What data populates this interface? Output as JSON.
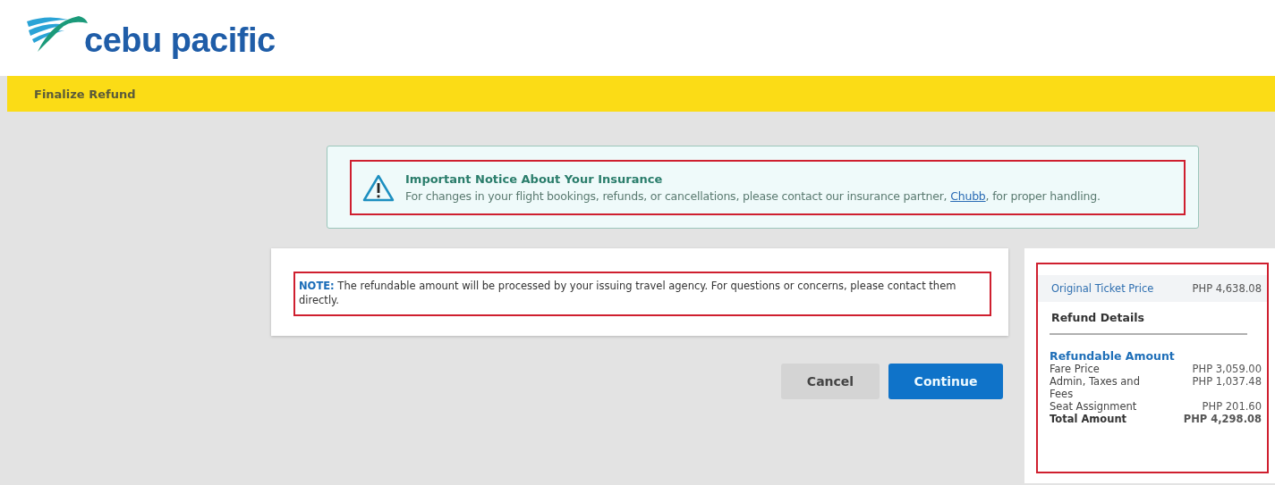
{
  "brand": {
    "name": "cebu pacific"
  },
  "page_bar": {
    "title": "Finalize Refund"
  },
  "insurance_notice": {
    "title": "Important Notice About Your Insurance",
    "text_before": "For changes in your flight bookings, refunds, or cancellations, please contact our insurance partner, ",
    "link": "Chubb",
    "text_after": ", for proper handling."
  },
  "note": {
    "label": "NOTE:",
    "text": "The refundable amount will be processed by your issuing travel agency. For questions or concerns, please contact them directly."
  },
  "buttons": [
    {
      "label": "Cancel",
      "kind": "secondary"
    },
    {
      "label": "Continue",
      "kind": "primary"
    }
  ],
  "summary": {
    "original_label": "Original Ticket Price",
    "original_value": "PHP 4,638.08",
    "heading": "Refund Details",
    "section": "Refundable Amount",
    "rows": [
      {
        "label": "Fare Price",
        "value": "PHP 3,059.00",
        "kind": "item"
      },
      {
        "label": "Admin, Taxes and Fees",
        "value": "PHP 1,037.48",
        "kind": "item"
      },
      {
        "label": "Seat Assignment",
        "value": "PHP 201.60",
        "kind": "item"
      },
      {
        "label": "Total Amount",
        "value": "PHP 4,298.08",
        "kind": "total"
      }
    ]
  }
}
